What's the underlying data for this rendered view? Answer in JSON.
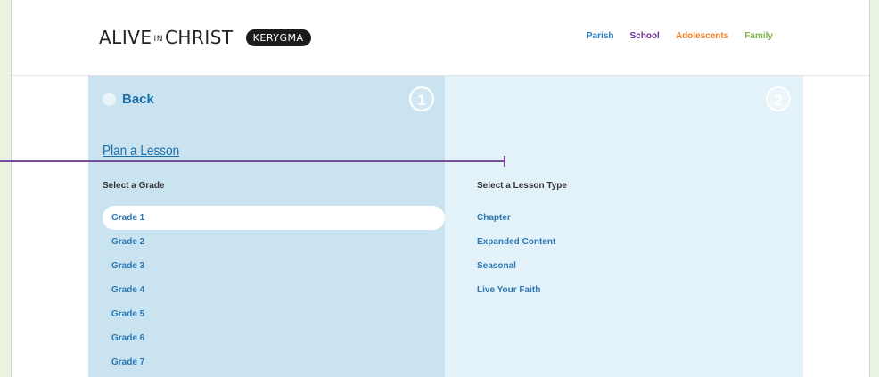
{
  "logo": {
    "part1": "ALIVE",
    "small": "IN",
    "part2": "CHRIST",
    "badge": "KERYGMA"
  },
  "topnav": [
    {
      "label": "Parish",
      "color": "#2a7fc1"
    },
    {
      "label": "School",
      "color": "#6a2f93"
    },
    {
      "label": "Adolescents",
      "color": "#f0822a"
    },
    {
      "label": "Family",
      "color": "#7ab648"
    }
  ],
  "back": {
    "label": "Back"
  },
  "steps": {
    "one": "1",
    "two": "2"
  },
  "plan": {
    "title": "Plan a Lesson"
  },
  "grades": {
    "label": "Select a Grade",
    "items": [
      "Grade 1",
      "Grade 2",
      "Grade 3",
      "Grade 4",
      "Grade 5",
      "Grade 6",
      "Grade 7"
    ],
    "selected": "Grade 1"
  },
  "lesson_types": {
    "label": "Select a Lesson Type",
    "items": [
      "Chapter",
      "Expanded Content",
      "Seasonal",
      "Live Your Faith"
    ]
  }
}
